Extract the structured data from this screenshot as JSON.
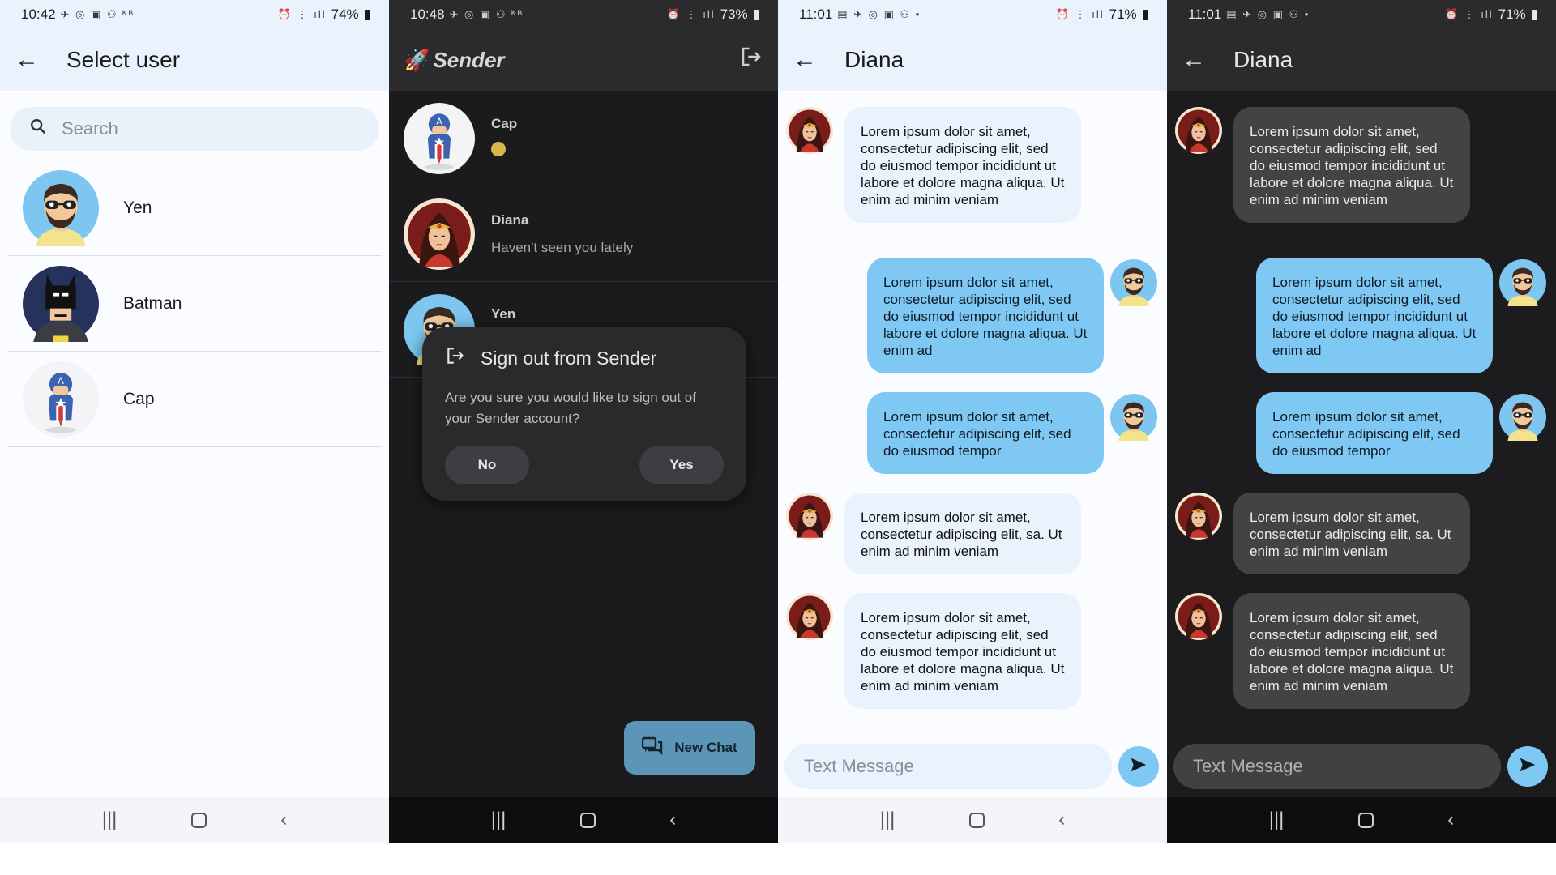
{
  "screens": {
    "select_user": {
      "status": {
        "time": "10:42",
        "battery": "74%",
        "icons": "✈ ◎ ▣ ⚇ ᴷᴮ"
      },
      "title": "Select user",
      "search_placeholder": "Search",
      "users": [
        {
          "name": "Yen"
        },
        {
          "name": "Batman"
        },
        {
          "name": "Cap"
        }
      ]
    },
    "chats": {
      "status": {
        "time": "10:48",
        "battery": "73%",
        "icons": "✈ ◎ ▣ ⚇ ᴷᴮ"
      },
      "app_name": "Sender",
      "chats": [
        {
          "name": "Cap",
          "message": ""
        },
        {
          "name": "Diana",
          "message": "Haven't seen you lately"
        },
        {
          "name": "Yen",
          "message": ""
        }
      ],
      "dialog": {
        "title": "Sign out from Sender",
        "body": "Are you sure you would like to sign out of your Sender account?",
        "no_label": "No",
        "yes_label": "Yes"
      },
      "fab_label": "New Chat"
    },
    "conversation_light": {
      "status": {
        "time": "11:01",
        "battery": "71%",
        "icons": "▤ ✈ ◎ ▣ ⚇ •"
      },
      "title": "Diana",
      "input_placeholder": "Text Message"
    },
    "conversation_dark": {
      "status": {
        "time": "11:01",
        "battery": "71%",
        "icons": "▤ ✈ ◎ ▣ ⚇ •"
      },
      "title": "Diana",
      "input_placeholder": "Text Message"
    }
  },
  "messages": [
    "Lorem ipsum dolor sit amet, consectetur adipiscing elit, sed do eiusmod tempor incididunt ut labore et dolore magna aliqua. Ut enim ad minim veniam",
    "Lorem ipsum dolor sit amet, consectetur adipiscing elit, sed do eiusmod tempor incididunt ut labore et dolore magna aliqua. Ut enim ad",
    "Lorem ipsum dolor sit amet, consectetur adipiscing elit, sed do eiusmod tempor",
    "Lorem ipsum dolor sit amet, consectetur adipiscing elit, sa. Ut enim ad minim veniam",
    "Lorem ipsum dolor sit amet, consectetur adipiscing elit, sed do eiusmod tempor incididunt ut labore et dolore magna aliqua. Ut enim ad minim veniam"
  ],
  "colors": {
    "accent": "#7fc8f4",
    "fab": "#5b95b7",
    "light_bg": "#fafcff",
    "dark_bg": "#1c1c1e"
  },
  "icons": {
    "back": "arrow-left-icon",
    "search": "search-icon",
    "signout": "logout-icon",
    "send": "send-icon",
    "new_chat": "chat-bubbles-icon"
  }
}
